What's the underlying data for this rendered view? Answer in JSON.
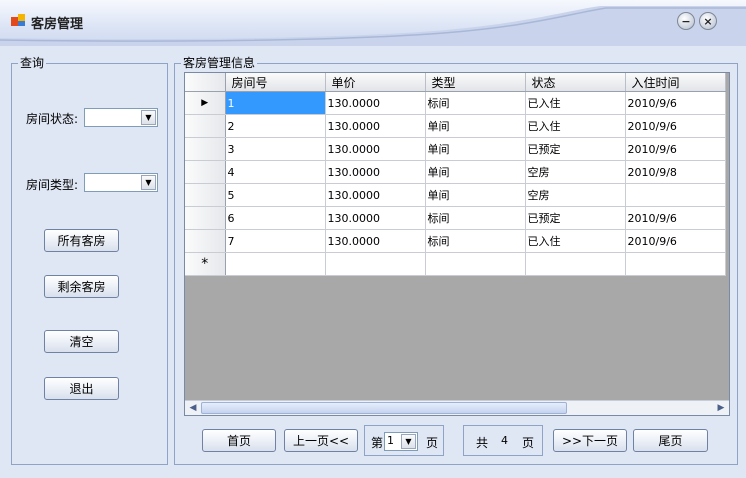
{
  "window": {
    "title": "客房管理"
  },
  "query": {
    "group_label": "查询",
    "status_label": "房间状态:",
    "status_value": "",
    "type_label": "房间类型:",
    "type_value": "",
    "buttons": {
      "all_rooms": "所有客房",
      "remaining_rooms": "剩余客房",
      "clear": "清空",
      "exit": "退出"
    }
  },
  "info": {
    "group_label": "客房管理信息",
    "columns": [
      "房间号",
      "单价",
      "类型",
      "状态",
      "入住时间"
    ],
    "rows": [
      [
        "1",
        "130.0000",
        "标间",
        "已入住",
        "2010/9/6"
      ],
      [
        "2",
        "130.0000",
        "单间",
        "已入住",
        "2010/9/6"
      ],
      [
        "3",
        "130.0000",
        "单间",
        "已预定",
        "2010/9/6"
      ],
      [
        "4",
        "130.0000",
        "单间",
        "空房",
        "2010/9/8"
      ],
      [
        "5",
        "130.0000",
        "单间",
        "空房",
        ""
      ],
      [
        "6",
        "130.0000",
        "标间",
        "已预定",
        "2010/9/6"
      ],
      [
        "7",
        "130.0000",
        "标间",
        "已入住",
        "2010/9/6"
      ]
    ],
    "current_row_marker": "▶",
    "new_row_marker": "*"
  },
  "pager": {
    "first": "首页",
    "prev": "上一页<<",
    "page_prefix": "第",
    "page_value": "1",
    "page_suffix": "页",
    "total_prefix": "共",
    "total_value": "4",
    "total_suffix": "页",
    "next": ">>下一页",
    "last": "尾页"
  },
  "icons": {
    "app": "app-icon",
    "minimize": "minimize-icon",
    "close": "close-icon"
  }
}
